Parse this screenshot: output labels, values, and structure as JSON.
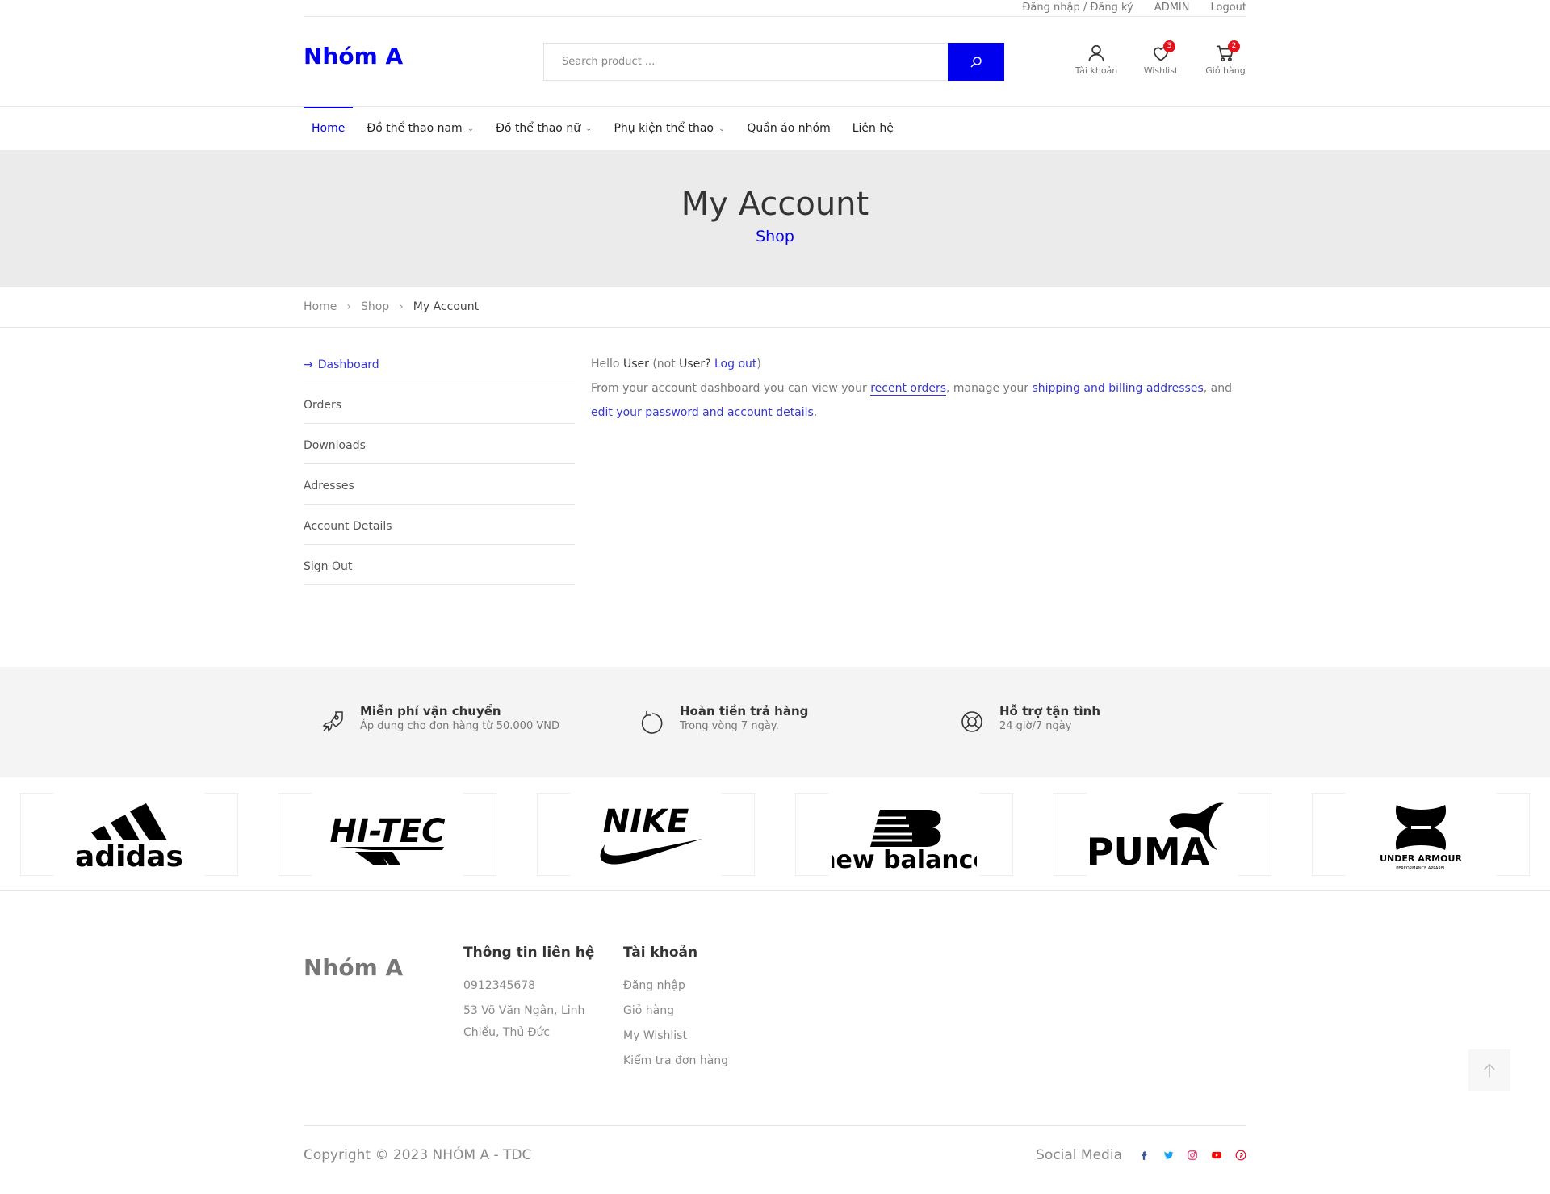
{
  "topbar": {
    "login_register": "Đăng nhập / Đăng ký",
    "admin": "ADMIN",
    "logout": "Logout"
  },
  "header": {
    "logo": "Nhóm A",
    "search_placeholder": "Search product ...",
    "account_label": "Tài khoản",
    "wishlist_label": "Wishlist",
    "wishlist_count": "3",
    "cart_label": "Giỏ hàng",
    "cart_count": "2"
  },
  "nav": {
    "items": [
      {
        "label": "Home"
      },
      {
        "label": "Đồ thể thao nam"
      },
      {
        "label": "Đồ thể thao nữ"
      },
      {
        "label": "Phụ kiện thể thao"
      },
      {
        "label": "Quần áo nhóm"
      },
      {
        "label": "Liên hệ"
      }
    ]
  },
  "hero": {
    "title": "My Account",
    "subtitle": "Shop"
  },
  "breadcrumb": {
    "items": [
      "Home",
      "Shop",
      "My Account"
    ]
  },
  "sidebar": {
    "items": [
      {
        "label": "Dashboard"
      },
      {
        "label": "Orders"
      },
      {
        "label": "Downloads"
      },
      {
        "label": "Adresses"
      },
      {
        "label": "Account Details"
      },
      {
        "label": "Sign Out"
      }
    ]
  },
  "dashboard": {
    "hello": "Hello",
    "user": "User",
    "not_prefix": "(not",
    "user2": "User",
    "question": "?",
    "logout_link": "Log out",
    "close_paren": ")",
    "line2_a": "From your account dashboard you can view your",
    "recent_orders": "recent orders",
    "line2_b": ", manage your",
    "addresses_link": "shipping and billing addresses",
    "line2_c": ", and",
    "edit_link": "edit your password and account details",
    "period": "."
  },
  "features": [
    {
      "title": "Miễn phí vận chuyển",
      "desc": "Áp dụng cho đơn hàng từ 50.000 VND"
    },
    {
      "title": "Hoàn tiền trả hàng",
      "desc": "Trong vòng 7 ngày."
    },
    {
      "title": "Hỗ trợ tận tình",
      "desc": "24 giờ/7 ngày"
    }
  ],
  "brands": [
    "adidas",
    "HI-TEC",
    "NIKE",
    "new balance",
    "PUMA",
    "UNDER ARMOUR",
    "PERFORMANCE APPAREL"
  ],
  "footer": {
    "logo": "Nhóm A",
    "contact": {
      "title": "Thông tin liên hệ",
      "phone": "0912345678",
      "address": "53 Võ Văn Ngân, Linh Chiểu, Thủ Đức"
    },
    "account": {
      "title": "Tài khoản",
      "items": [
        "Đăng nhập",
        "Giỏ hàng",
        "My Wishlist",
        "Kiểm tra đơn hàng"
      ]
    },
    "copyright": "Copyright © 2023 NHÓM A - TDC",
    "social_label": "Social Media"
  },
  "colors": {
    "accent": "#0000ee",
    "badge": "#e4111f",
    "facebook": "#3b5998",
    "twitter": "#1da1f2",
    "instagram": "#e1306c",
    "youtube": "#ff0000",
    "pinterest": "#e60023"
  }
}
